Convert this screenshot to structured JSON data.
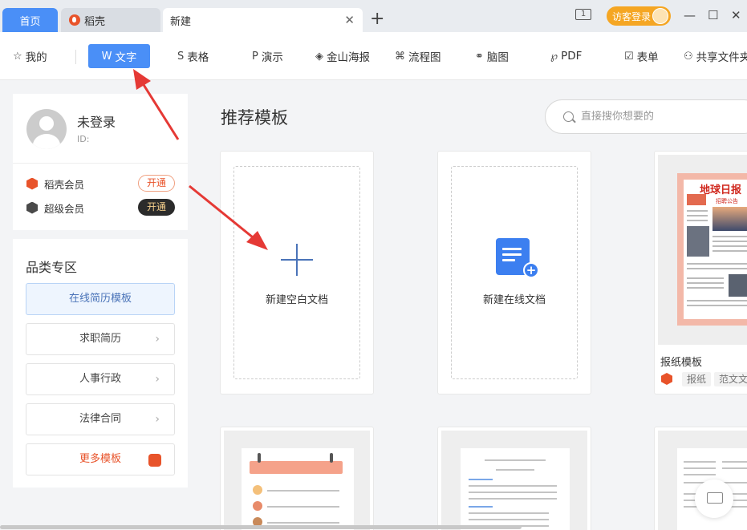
{
  "tabs": {
    "home": "首页",
    "daoke": "稻壳",
    "new": "新建"
  },
  "header": {
    "login_label": "访客登录",
    "page_count": "1"
  },
  "toolbar": {
    "mine": "我的",
    "text": "文字",
    "sheet": "表格",
    "slides": "演示",
    "poster": "金山海报",
    "flowchart": "流程图",
    "mindmap": "脑图",
    "pdf": "PDF",
    "form": "表单",
    "shared": "共享文件夹"
  },
  "user": {
    "name": "未登录",
    "id_label": "ID:",
    "memberships": [
      {
        "name": "稻壳会员",
        "action": "开通"
      },
      {
        "name": "超级会员",
        "action": "开通"
      }
    ]
  },
  "categories": {
    "title": "品类专区",
    "items": [
      "在线简历模板",
      "求职简历",
      "人事行政",
      "法律合同",
      "更多模板"
    ]
  },
  "main": {
    "title": "推荐模板",
    "search_placeholder": "直接搜你想要的",
    "cards": {
      "blank": "新建空白文档",
      "online": "新建在线文档",
      "newspaper": "报纸模板",
      "tags": [
        "报纸",
        "范文文档"
      ],
      "newspaper_title": "地球日报",
      "newspaper_sub": "招聘公告"
    }
  },
  "colors": {
    "accent": "#4a8ff7",
    "daoke_orange": "#e8532a",
    "login_orange": "#f5a623",
    "annotation_red": "#e53935"
  }
}
